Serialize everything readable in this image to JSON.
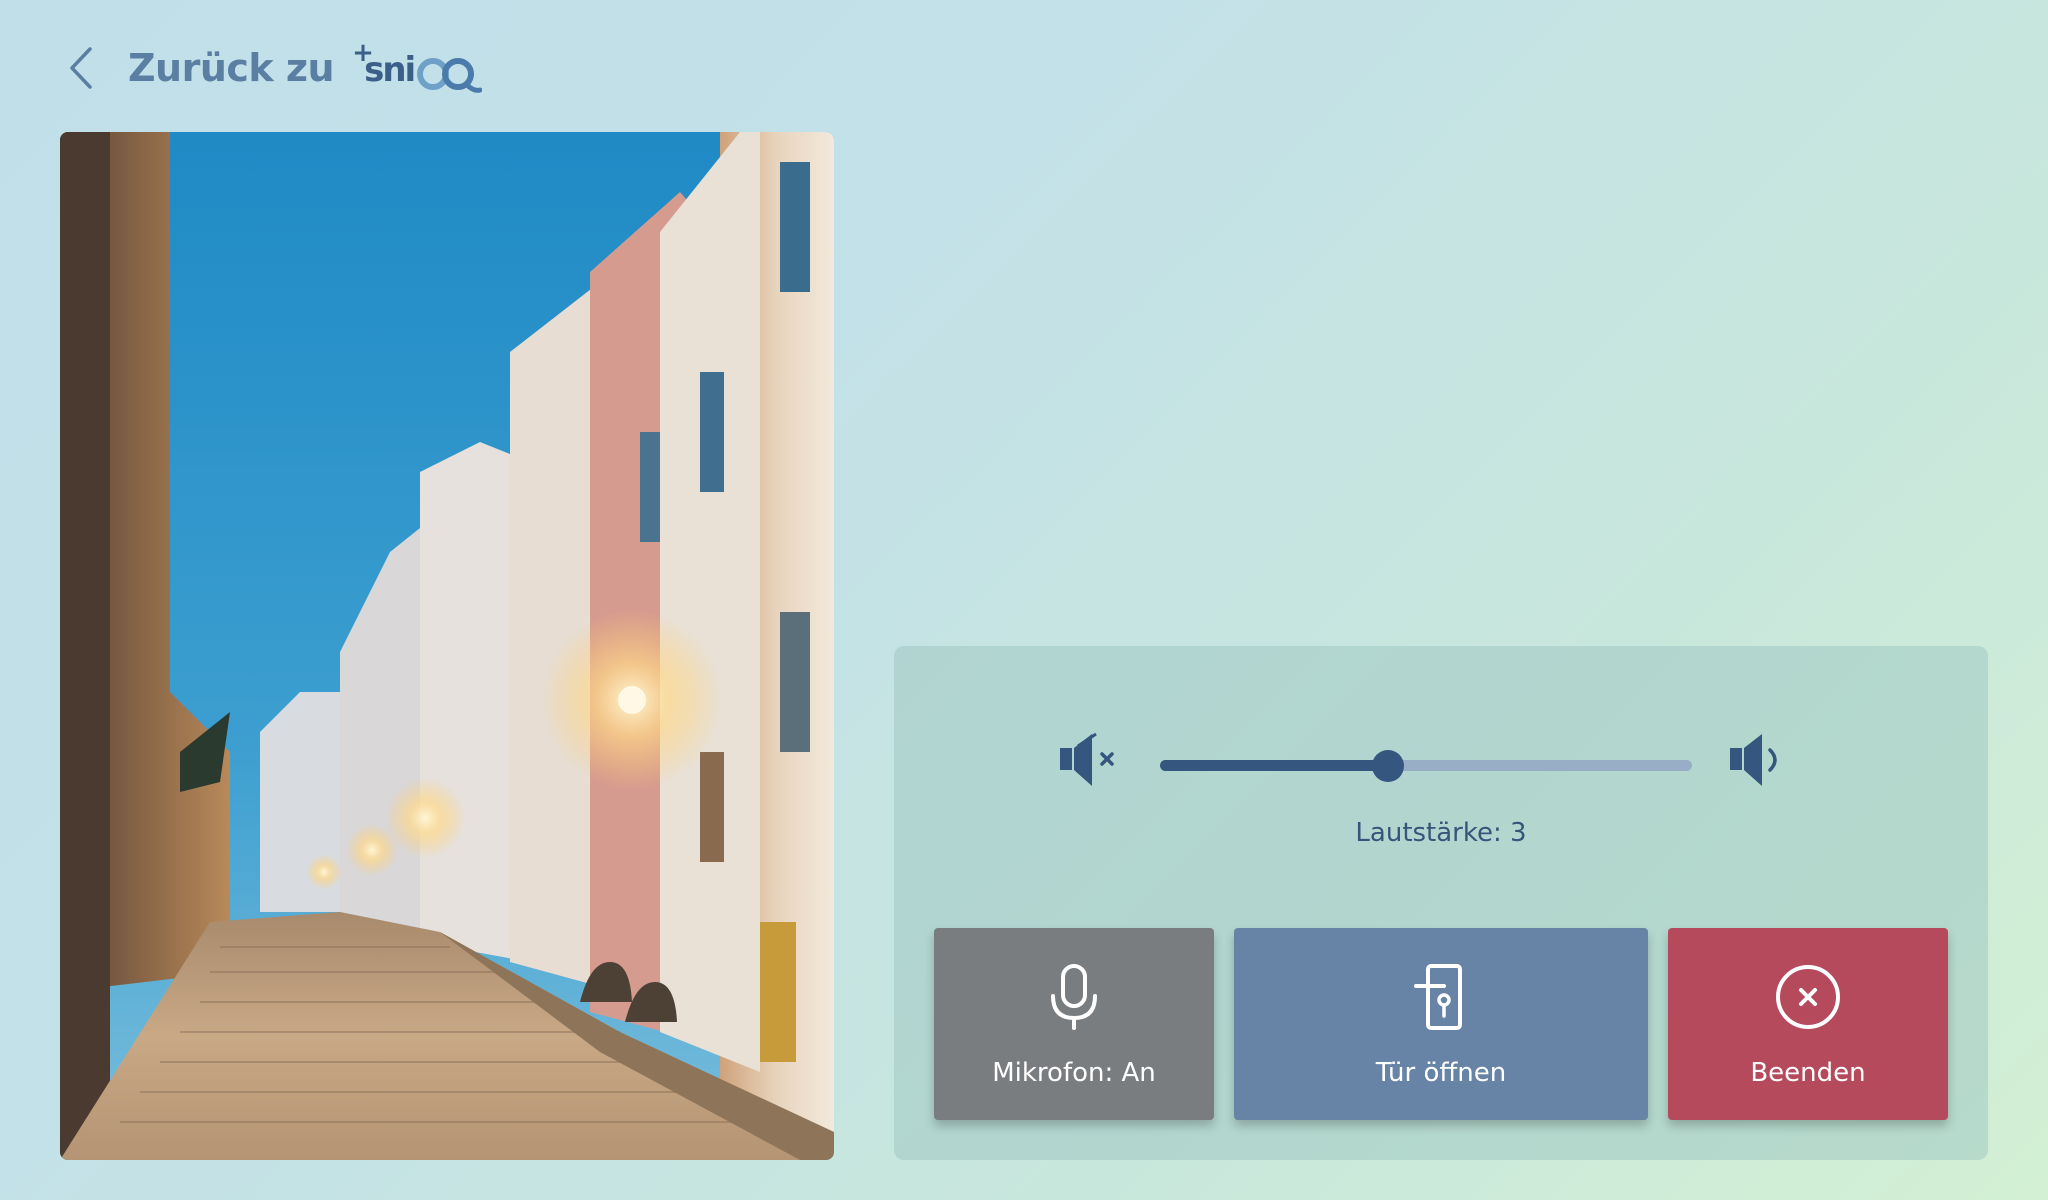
{
  "header": {
    "back_label": "Zurück zu",
    "back_icon": "chevron-left-icon",
    "logo_plus": "+",
    "logo_text": "sni",
    "logo_qq": "QQ"
  },
  "camera": {
    "icon": "camera-feed-image"
  },
  "volume": {
    "label": "Lautstärke: 3",
    "level": 3,
    "max": 7,
    "min_icon": "speaker-mute-icon",
    "max_icon": "speaker-loud-icon"
  },
  "actions": {
    "mic": {
      "label": "Mikrofon: An",
      "icon": "microphone-icon",
      "color": "#7a7d80"
    },
    "door": {
      "label": "Tür öffnen",
      "icon": "door-open-icon",
      "color": "#6784a6"
    },
    "end": {
      "label": "Beenden",
      "icon": "close-circle-icon",
      "color": "#b64a5d"
    }
  },
  "colors": {
    "accent": "#34567f",
    "track": "#98adc6",
    "header_text": "#5b7fa2"
  }
}
